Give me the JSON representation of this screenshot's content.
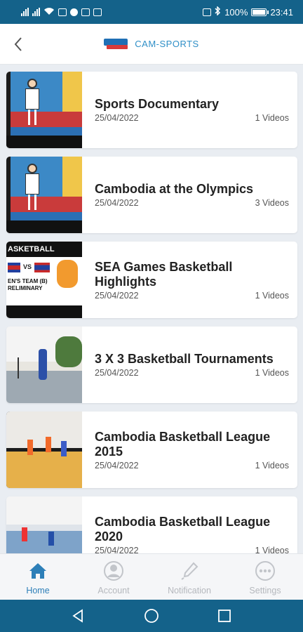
{
  "status_bar": {
    "battery": "100%",
    "time": "23:41",
    "icons": [
      "signal-icon",
      "signal-icon",
      "wifi-icon",
      "sim-icon",
      "notification-icon",
      "bluetooth-icon",
      "battery-icon"
    ]
  },
  "header": {
    "title": "CAM-SPORTS",
    "back_icon": "chevron-left-icon",
    "logo": "cam-sports-logo"
  },
  "playlists": [
    {
      "title": "Sports Documentary",
      "date": "25/04/2022",
      "count": "1 Videos",
      "thumb": "olympics-cartoon"
    },
    {
      "title": "Cambodia at the Olympics",
      "date": "25/04/2022",
      "count": "3 Videos",
      "thumb": "olympics-cartoon"
    },
    {
      "title": "SEA Games Basketball Highlights",
      "date": "25/04/2022",
      "count": "1 Videos",
      "thumb": "sea-games-basketball",
      "thumb_text": {
        "banner": "ASKETBALL",
        "vs": "VS",
        "caption": "EN'S TEAM (B) RELIMINARY"
      }
    },
    {
      "title": "3 X 3 Basketball Tournaments",
      "date": "25/04/2022",
      "count": "1 Videos",
      "thumb": "outdoor-basketball"
    },
    {
      "title": "Cambodia Basketball League 2015",
      "date": "25/04/2022",
      "count": "1 Videos",
      "thumb": "indoor-basketball"
    },
    {
      "title": "Cambodia Basketball League 2020",
      "date": "25/04/2022",
      "count": "1 Videos",
      "thumb": "indoor-basketball-2"
    }
  ],
  "bottom_nav": [
    {
      "label": "Home",
      "icon": "home-icon",
      "active": true
    },
    {
      "label": "Account",
      "icon": "account-icon",
      "active": false
    },
    {
      "label": "Notification",
      "icon": "notification-icon",
      "active": false
    },
    {
      "label": "Settings",
      "icon": "settings-icon",
      "active": false
    }
  ],
  "system_nav": [
    "back-triangle-icon",
    "home-circle-icon",
    "recents-square-icon"
  ],
  "colors": {
    "primary": "#14628a",
    "accent": "#2d7fb8",
    "inactive": "#b5b8bd",
    "background": "#e9edf2"
  }
}
